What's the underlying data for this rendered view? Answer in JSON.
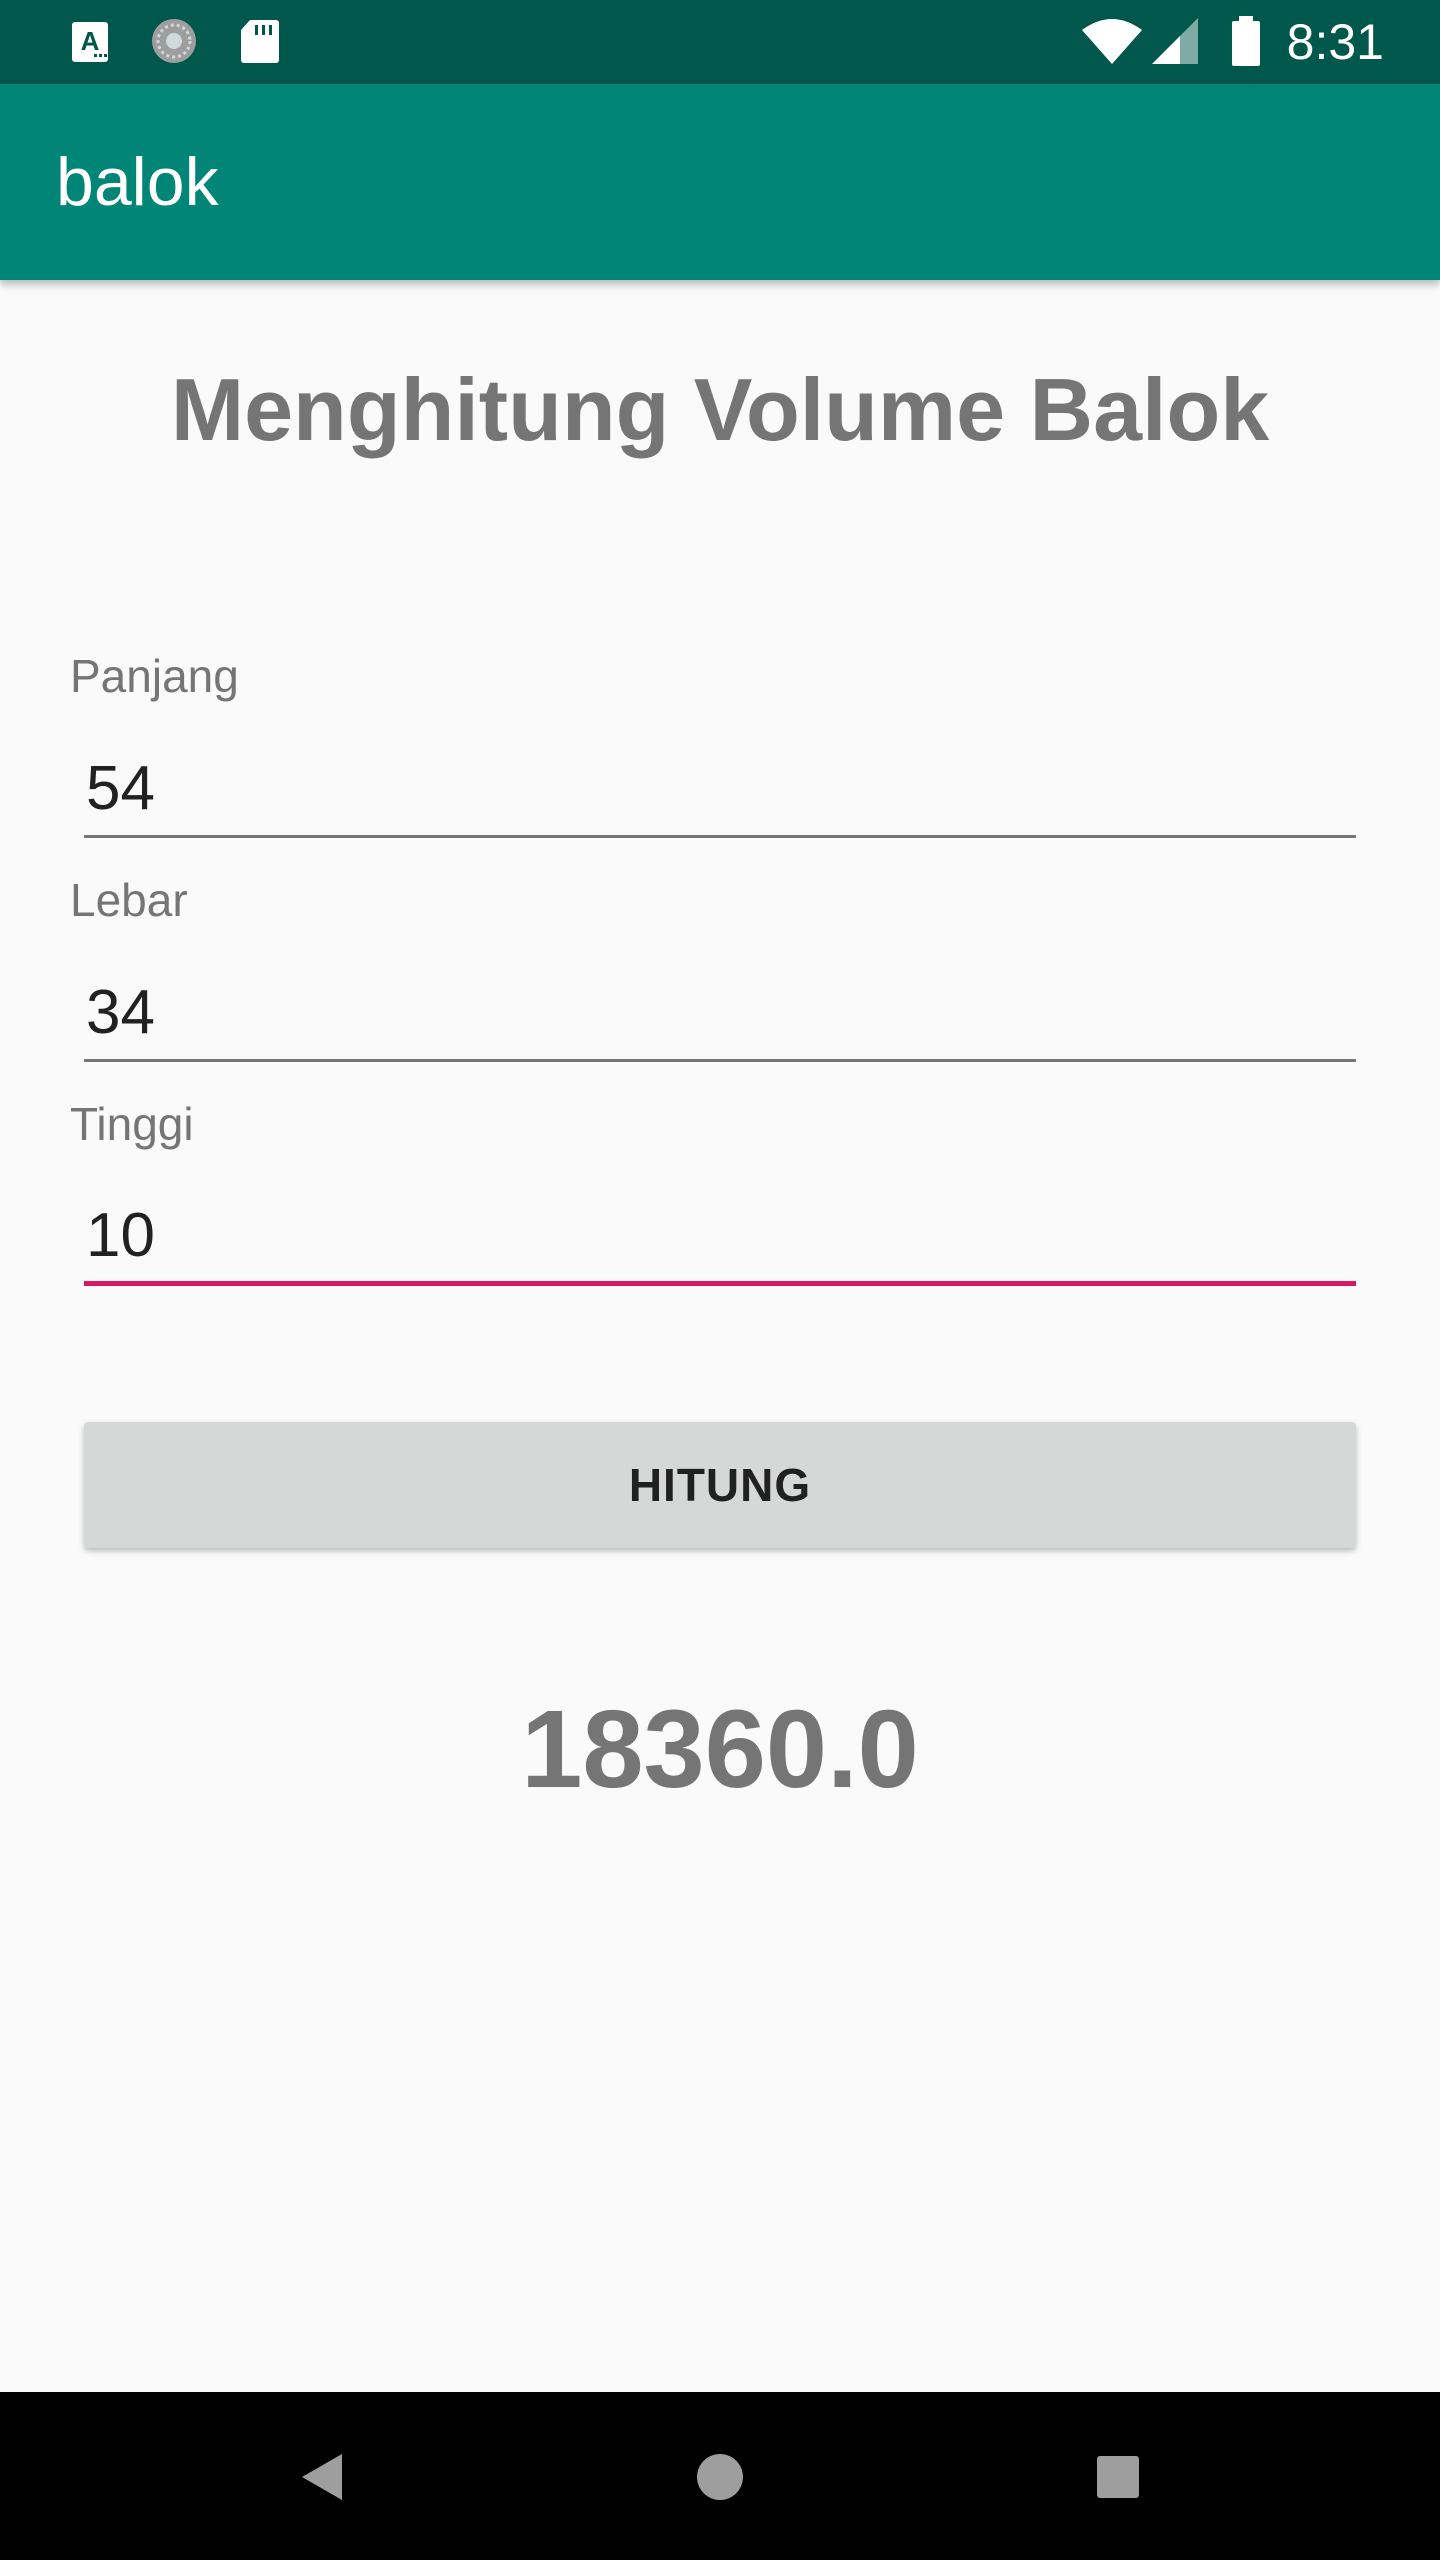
{
  "status_bar": {
    "time": "8:31",
    "icons": [
      "notification-a-icon",
      "sync-icon",
      "sd-card-icon",
      "wifi-icon",
      "cellular-signal-icon",
      "battery-icon"
    ]
  },
  "app_bar": {
    "title": "balok",
    "color": "#008577"
  },
  "main": {
    "heading": "Menghitung Volume Balok",
    "fields": [
      {
        "label": "Panjang",
        "value": "54"
      },
      {
        "label": "Lebar",
        "value": "34"
      },
      {
        "label": "Tinggi",
        "value": "10"
      }
    ],
    "button_label": "HITUNG",
    "result": "18360.0"
  },
  "nav_bar": {
    "icons": [
      "back-icon",
      "home-icon",
      "recents-icon"
    ]
  },
  "colors": {
    "status_bar": "#00574b",
    "accent": "#d81b60",
    "text_secondary": "#757575"
  }
}
